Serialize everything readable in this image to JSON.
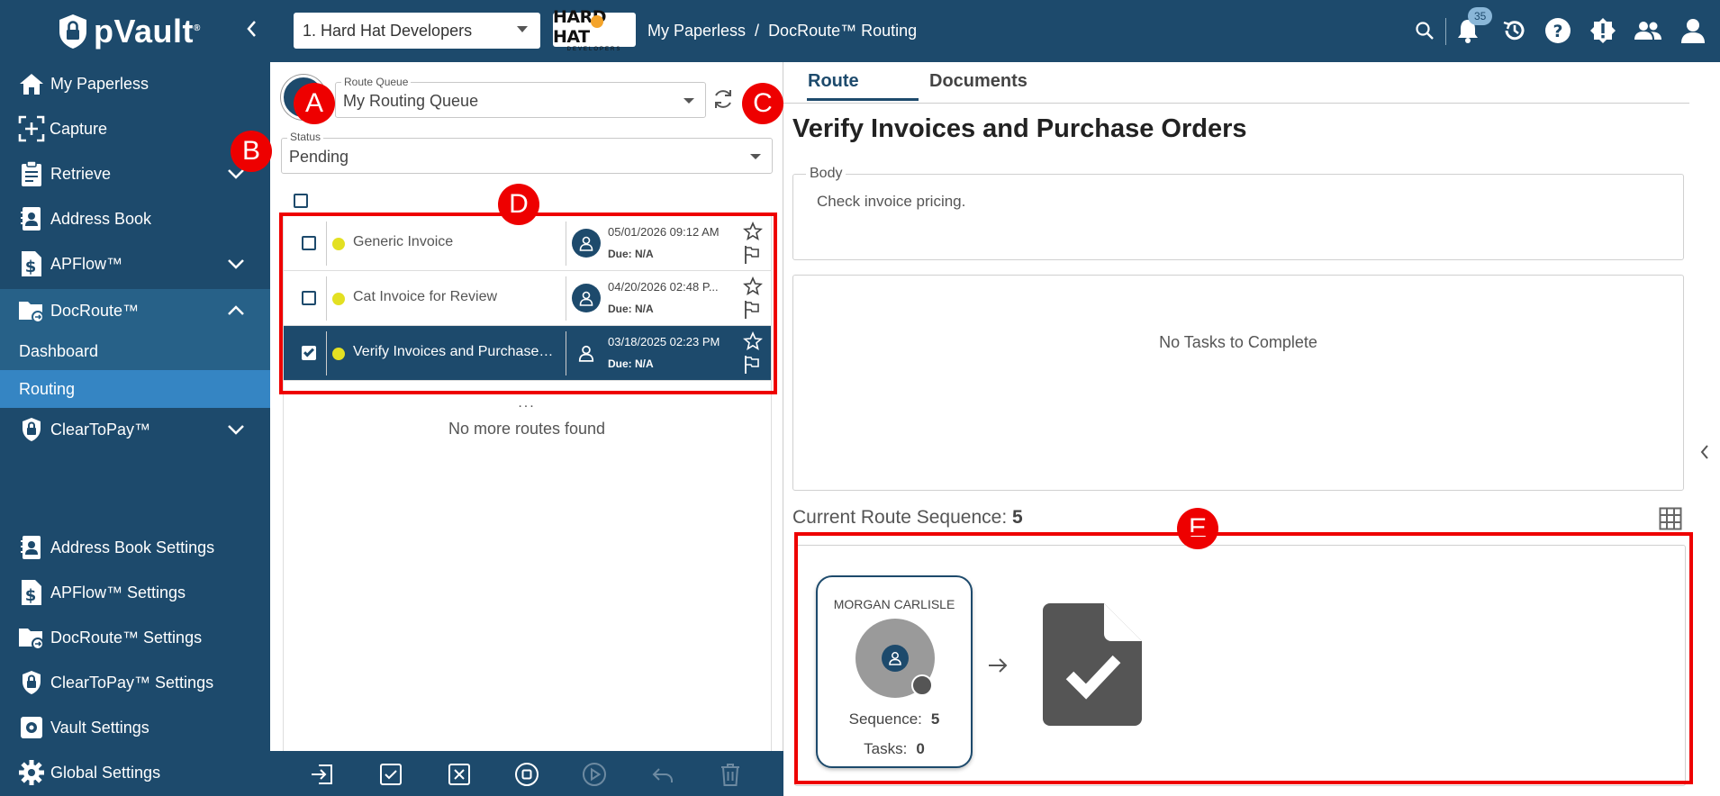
{
  "app": {
    "name": "pVault",
    "trademark": "®"
  },
  "header": {
    "company": "1. Hard Hat Developers",
    "company_logo": {
      "main": "HARD HAT",
      "sub": "DEVELOPERS"
    },
    "breadcrumb": [
      "My Paperless",
      "/",
      "DocRoute™ Routing"
    ],
    "notification_count": "35"
  },
  "sidebar": {
    "items": [
      {
        "label": "My Paperless",
        "icon": "home-icon"
      },
      {
        "label": "Capture",
        "icon": "capture-icon"
      },
      {
        "label": "Retrieve",
        "icon": "clipboard-icon"
      },
      {
        "label": "Address Book",
        "icon": "address-book-icon"
      },
      {
        "label": "APFlow™",
        "icon": "dollar-doc-icon"
      },
      {
        "label": "DocRoute™",
        "icon": "folder-route-icon"
      },
      {
        "label": "ClearToPay™",
        "icon": "shield-lock-icon"
      }
    ],
    "docroute_sub": [
      "Dashboard",
      "Routing"
    ],
    "settings": [
      {
        "label": "Address Book Settings"
      },
      {
        "label": "APFlow™ Settings"
      },
      {
        "label": "DocRoute™ Settings"
      },
      {
        "label": "ClearToPay™ Settings"
      },
      {
        "label": "Vault Settings"
      },
      {
        "label": "Global Settings"
      }
    ]
  },
  "routes_panel": {
    "route_queue_label": "Route Queue",
    "route_queue_value": "My Routing Queue",
    "status_label": "Status",
    "status_value": "Pending",
    "rows": [
      {
        "title": "Generic Invoice",
        "date": "05/01/2026 09:12 AM",
        "due": "Due: N/A",
        "selected": false
      },
      {
        "title": "Cat Invoice for Review",
        "date": "04/20/2026 02:48 P...",
        "due": "Due: N/A",
        "selected": false
      },
      {
        "title": "Verify Invoices and Purchase O...",
        "date": "03/18/2025 02:23 PM",
        "due": "Due: N/A",
        "selected": true
      }
    ],
    "ellipsis": "...",
    "no_more": "No more routes found"
  },
  "detail": {
    "tabs": [
      "Route",
      "Documents"
    ],
    "title": "Verify Invoices and Purchase Orders",
    "body_label": "Body",
    "body_text": "Check invoice pricing.",
    "no_tasks": "No Tasks to Complete",
    "sequence_label": "Current Route Sequence:",
    "sequence_value": "5",
    "card": {
      "name": "MORGAN CARLISLE",
      "sequence_label": "Sequence:",
      "sequence_value": "5",
      "tasks_label": "Tasks:",
      "tasks_value": "0"
    }
  },
  "annotations": [
    "A",
    "B",
    "C",
    "D",
    "E"
  ],
  "colors": {
    "primary": "#1d4a6c",
    "active_nav": "#3585c3",
    "accent_red": "#e00000",
    "status_dot": "#e3e022"
  }
}
